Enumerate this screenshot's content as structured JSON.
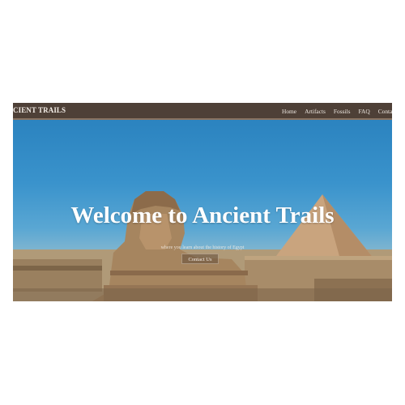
{
  "nav": {
    "brand": "CIENT TRAILS",
    "links": [
      "Home",
      "Artifacts",
      "Fossils",
      "FAQ",
      "Conta"
    ]
  },
  "hero": {
    "title": "Welcome to Ancient Trails",
    "subtitle": "where you learn about the history of Egypt",
    "button": "Contact Us"
  },
  "colors": {
    "navbar_bg": "#4e4037",
    "sky": "#2b83bf",
    "sand": "#a8916f",
    "text": "#ffffff"
  }
}
